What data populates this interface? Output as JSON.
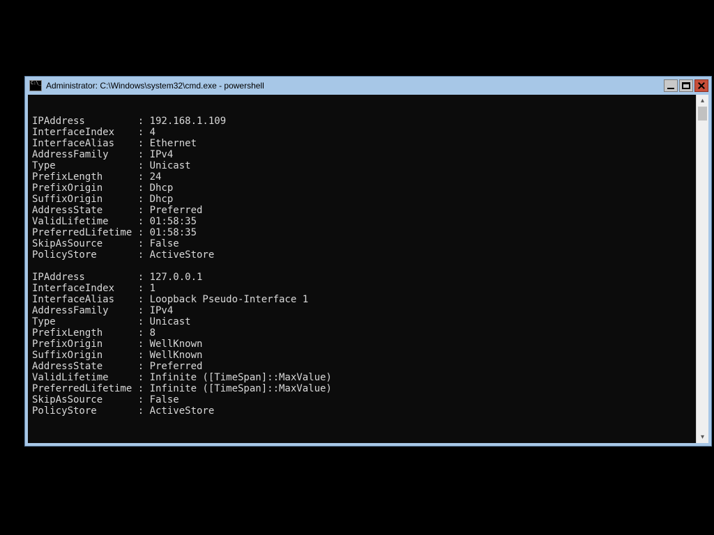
{
  "window": {
    "title": "Administrator: C:\\Windows\\system32\\cmd.exe - powershell"
  },
  "key_col_width": 18,
  "entries": [
    {
      "IPAddress": "192.168.1.109",
      "InterfaceIndex": "4",
      "InterfaceAlias": "Ethernet",
      "AddressFamily": "IPv4",
      "Type": "Unicast",
      "PrefixLength": "24",
      "PrefixOrigin": "Dhcp",
      "SuffixOrigin": "Dhcp",
      "AddressState": "Preferred",
      "ValidLifetime": "01:58:35",
      "PreferredLifetime": "01:58:35",
      "SkipAsSource": "False",
      "PolicyStore": "ActiveStore"
    },
    {
      "IPAddress": "127.0.0.1",
      "InterfaceIndex": "1",
      "InterfaceAlias": "Loopback Pseudo-Interface 1",
      "AddressFamily": "IPv4",
      "Type": "Unicast",
      "PrefixLength": "8",
      "PrefixOrigin": "WellKnown",
      "SuffixOrigin": "WellKnown",
      "AddressState": "Preferred",
      "ValidLifetime": "Infinite ([TimeSpan]::MaxValue)",
      "PreferredLifetime": "Infinite ([TimeSpan]::MaxValue)",
      "SkipAsSource": "False",
      "PolicyStore": "ActiveStore"
    }
  ]
}
